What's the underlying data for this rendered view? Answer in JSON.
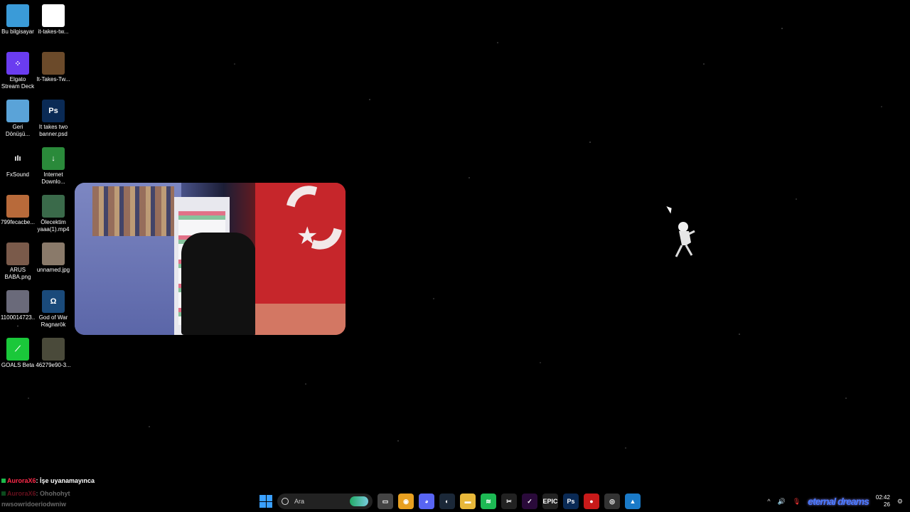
{
  "desktop": {
    "icons": [
      {
        "label": "Bu bilgisayar",
        "color": "#3a9bd8",
        "glyph": ""
      },
      {
        "label": "it-takes-tw...",
        "color": "#ffffff",
        "glyph": ""
      },
      {
        "label": "Elgato Stream Deck",
        "color": "#6a3cf0",
        "glyph": "⁘"
      },
      {
        "label": "It-Takes-Tw...",
        "color": "#6b4a2a",
        "glyph": ""
      },
      {
        "label": "Geri Dönüşü...",
        "color": "#5aa3d8",
        "glyph": ""
      },
      {
        "label": "It takes two banner.psd",
        "color": "#0a2a55",
        "glyph": "Ps"
      },
      {
        "label": "FxSound",
        "color": "#000000",
        "glyph": "ıIı"
      },
      {
        "label": "Internet Downlo...",
        "color": "#2a8a3a",
        "glyph": "↓"
      },
      {
        "label": "799fecacbe...",
        "color": "#b86a3a",
        "glyph": ""
      },
      {
        "label": "Ölecektim yaaa(1).mp4",
        "color": "#3a6a4a",
        "glyph": ""
      },
      {
        "label": "ARUS BABA.png",
        "color": "#7a5a4a",
        "glyph": ""
      },
      {
        "label": "unnamed.jpg",
        "color": "#8a7a6a",
        "glyph": ""
      },
      {
        "label": "1100014723...",
        "color": "#6a6a7a",
        "glyph": ""
      },
      {
        "label": "God of War Ragnarök",
        "color": "#1a4a7a",
        "glyph": "Ω"
      },
      {
        "label": "GOALS Beta",
        "color": "#1ac83a",
        "glyph": "⟋"
      },
      {
        "label": "46279e90-3...",
        "color": "#4a4a3a",
        "glyph": ""
      }
    ]
  },
  "chat": {
    "lines": [
      {
        "user": "AuroraX6",
        "message": ": İşe uyanamayınca"
      },
      {
        "user": "AuroraX6",
        "message": ": Ohohohyt"
      }
    ],
    "stream_title": "nwsowridoeriodwniw"
  },
  "taskbar": {
    "search_placeholder": "Ara",
    "apps": [
      {
        "name": "file-explorer-view",
        "glyph": "▭",
        "color": "#444"
      },
      {
        "name": "chrome",
        "glyph": "◉",
        "color": "#e8a020"
      },
      {
        "name": "discord",
        "glyph": "◕",
        "color": "#5865f2"
      },
      {
        "name": "steam",
        "glyph": "◐",
        "color": "#1b2838"
      },
      {
        "name": "folder",
        "glyph": "▬",
        "color": "#e8b83a"
      },
      {
        "name": "spotify",
        "glyph": "≋",
        "color": "#1db954"
      },
      {
        "name": "capcut",
        "glyph": "✂",
        "color": "#222"
      },
      {
        "name": "premiere",
        "glyph": "✓",
        "color": "#2a0a3a"
      },
      {
        "name": "epic-games",
        "glyph": "EPIC",
        "color": "#222"
      },
      {
        "name": "photoshop",
        "glyph": "Ps",
        "color": "#0a2a55"
      },
      {
        "name": "record",
        "glyph": "●",
        "color": "#c81a1a"
      },
      {
        "name": "obs",
        "glyph": "◎",
        "color": "#333"
      },
      {
        "name": "photos",
        "glyph": "▲",
        "color": "#1a7ac8"
      }
    ]
  },
  "tray": {
    "chevron": "^",
    "brand_text": "eternal dreams",
    "time": "02:42",
    "date": "26"
  }
}
